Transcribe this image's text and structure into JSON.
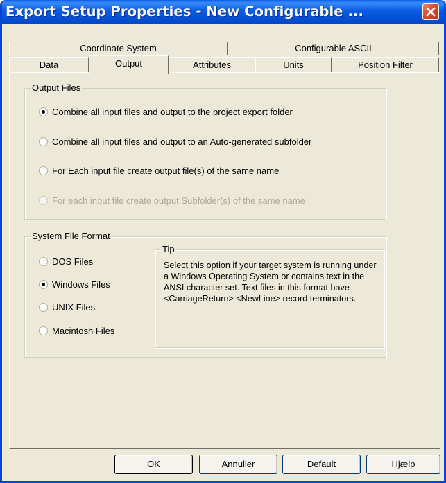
{
  "window": {
    "title": "Export Setup Properties - New Configurable ..."
  },
  "tabs": {
    "row1": [
      "Coordinate System",
      "Configurable ASCII"
    ],
    "row2": [
      "Data",
      "Output",
      "Attributes",
      "Units",
      "Position Filter"
    ],
    "active": "Output"
  },
  "output_files": {
    "legend": "Output Files",
    "options": [
      {
        "label": "Combine all input files and output to the project export folder",
        "checked": true,
        "enabled": true
      },
      {
        "label": "Combine all input files and output to an Auto-generated subfolder",
        "checked": false,
        "enabled": true
      },
      {
        "label": "For Each input file create output file(s) of the same name",
        "checked": false,
        "enabled": true
      },
      {
        "label": "For each input file create output Subfolder(s) of the same name",
        "checked": false,
        "enabled": false
      }
    ]
  },
  "system_file_format": {
    "legend": "System File Format",
    "options": [
      {
        "label": "DOS Files",
        "checked": false
      },
      {
        "label": "Windows Files",
        "checked": true
      },
      {
        "label": "UNIX Files",
        "checked": false
      },
      {
        "label": "Macintosh Files",
        "checked": false
      }
    ],
    "tip": {
      "legend": "Tip",
      "text": "Select this option if your target system is running under a Windows Operating System or contains text in the ANSI character set. Text files in this format have <CarriageReturn> <NewLine> record terminators."
    }
  },
  "buttons": {
    "ok": "OK",
    "cancel": "Annuller",
    "default": "Default",
    "help": "Hjælp"
  },
  "colors": {
    "titlebar": "#0452d6",
    "close": "#d8492c",
    "face": "#ece9d8"
  }
}
